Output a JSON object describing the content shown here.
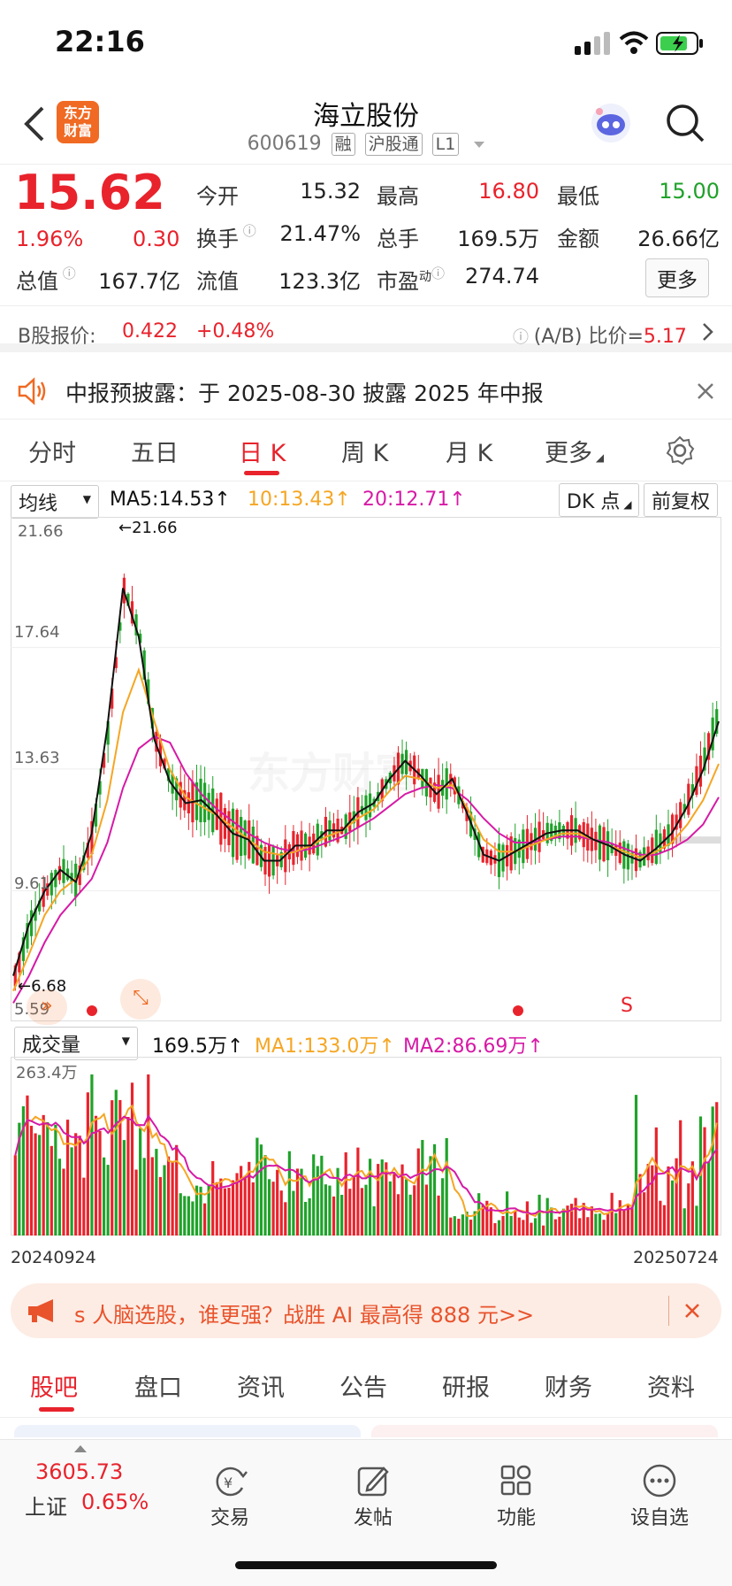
{
  "status": {
    "time": "22:16"
  },
  "header": {
    "stock_name": "海立股份",
    "code": "600619",
    "tags": [
      "融",
      "沪股通",
      "L1"
    ],
    "logo_text_1": "东方",
    "logo_text_2": "财富"
  },
  "quote": {
    "price": "15.62",
    "pct": "1.96%",
    "change": "0.30",
    "open_label": "今开",
    "open": "15.32",
    "high_label": "最高",
    "high": "16.80",
    "low_label": "最低",
    "low": "15.00",
    "turnover_label": "换手",
    "turnover": "21.47%",
    "volume_label": "总手",
    "volume": "169.5万",
    "amount_label": "金额",
    "amount": "26.66亿",
    "mktcap_label": "总值",
    "mktcap": "167.7亿",
    "float_label": "流值",
    "float": "123.3亿",
    "pe_label": "市盈",
    "pe_sup": "动",
    "pe": "274.74",
    "more_button": "更多"
  },
  "bshare": {
    "label": "B股报价:",
    "price": "0.422",
    "pct": "+0.48%",
    "ratio_label": "(A/B) 比价=",
    "ratio": "5.17"
  },
  "notice": {
    "text": "中报预披露：于 2025-08-30 披露 2025 年中报"
  },
  "ktabs": [
    "分时",
    "五日",
    "日 K",
    "周 K",
    "月 K",
    "更多"
  ],
  "ktabs_active": 2,
  "indicators": {
    "ma_select": "均线",
    "ma5": "MA5:14.53",
    "ma10": "10:13.43",
    "ma20": "20:12.71",
    "dk": "DK 点",
    "adjust": "前复权",
    "y_labels": [
      "21.66",
      "17.64",
      "13.63",
      "9.61",
      "5.59"
    ],
    "max_mark": "21.66",
    "min_mark": "6.68",
    "sell_mark": "S",
    "watermark": "东方财富"
  },
  "volume": {
    "select": "成交量",
    "value": "169.5万",
    "ma1": "MA1:133.0万",
    "ma2": "MA2:86.69万",
    "max_label": "263.4万",
    "date_start": "20240924",
    "date_end": "20250724"
  },
  "chart_data": {
    "type": "candlestick",
    "y_range": [
      5.59,
      21.66
    ],
    "ma5_shape": [
      6.8,
      8.5,
      9.6,
      10.3,
      9.9,
      11.5,
      15,
      19.6,
      18,
      14.6,
      13.2,
      12.5,
      12.6,
      12.1,
      11.5,
      11.3,
      10.6,
      10.6,
      11.1,
      11.1,
      11.6,
      11.6,
      12.2,
      12.5,
      13.3,
      13.9,
      13.4,
      12.8,
      13.3,
      12.1,
      10.8,
      10.6,
      10.9,
      11.2,
      11.5,
      11.6,
      11.6,
      11.3,
      11.1,
      10.8,
      10.6,
      11.0,
      11.5,
      12.4,
      13.6,
      15.2
    ],
    "ma10_shape": [
      6.3,
      7.5,
      8.8,
      9.6,
      10.0,
      10.8,
      12.6,
      15.5,
      16.9,
      15.2,
      13.6,
      12.7,
      12.4,
      12.1,
      11.7,
      11.3,
      10.9,
      10.8,
      10.9,
      11.1,
      11.4,
      11.6,
      12.0,
      12.3,
      12.9,
      13.4,
      13.3,
      13.0,
      13.1,
      12.3,
      11.3,
      10.9,
      10.9,
      11.1,
      11.3,
      11.5,
      11.5,
      11.3,
      11.1,
      10.9,
      10.7,
      10.9,
      11.2,
      11.8,
      12.6,
      13.8
    ],
    "ma20_shape": [
      5.9,
      6.8,
      7.9,
      8.8,
      9.4,
      10.0,
      11.2,
      13.0,
      14.3,
      14.7,
      14.5,
      13.5,
      12.8,
      12.3,
      11.9,
      11.5,
      11.2,
      11.0,
      10.9,
      11.0,
      11.2,
      11.4,
      11.7,
      12.0,
      12.4,
      12.8,
      13.0,
      13.1,
      13.0,
      12.6,
      12.0,
      11.5,
      11.2,
      11.2,
      11.3,
      11.4,
      11.4,
      11.3,
      11.2,
      11.0,
      10.8,
      10.8,
      11.0,
      11.3,
      11.8,
      12.7
    ],
    "volume_max": 263.4
  },
  "promo": {
    "text": "s 人脑选股，谁更强？战胜 AI 最高得 888 元>>"
  },
  "bottom_tabs": [
    "股吧",
    "盘口",
    "资讯",
    "公告",
    "研报",
    "财务",
    "资料"
  ],
  "bottom_tabs_active": 0,
  "index": {
    "value": "3605.73",
    "name": "上证",
    "pct": "0.65%"
  },
  "bottom_nav": [
    "交易",
    "发帖",
    "功能",
    "设自选"
  ]
}
